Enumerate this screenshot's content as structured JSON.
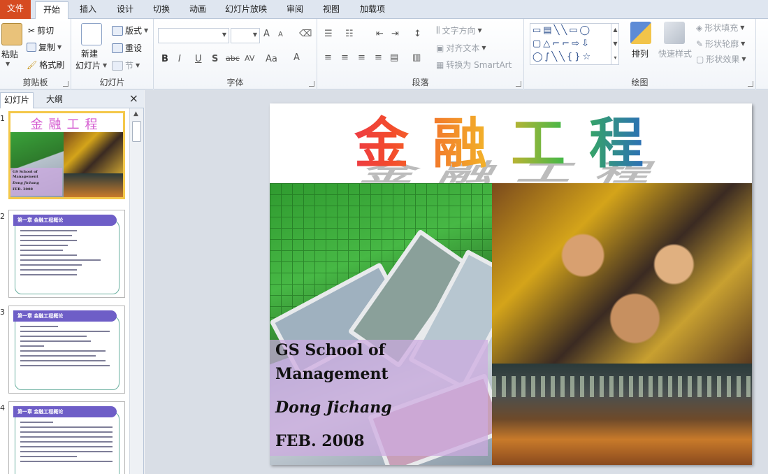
{
  "tabs": [
    "文件",
    "开始",
    "插入",
    "设计",
    "切换",
    "动画",
    "幻灯片放映",
    "审阅",
    "视图",
    "加载项"
  ],
  "ribbon": {
    "clipboard": {
      "paste": "粘贴",
      "cut": "剪切",
      "copy": "复制",
      "format_painter": "格式刷",
      "label": "剪贴板"
    },
    "slides": {
      "new_slide": "新建",
      "new_slide2": "幻灯片",
      "layout": "版式",
      "reset": "重设",
      "section": "节",
      "label": "幻灯片"
    },
    "font": {
      "bold": "B",
      "italic": "I",
      "underline": "U",
      "shadow": "S",
      "strike": "abc",
      "spacing": "AV",
      "case": "Aa",
      "color": "A",
      "grow": "A",
      "shrink": "A",
      "label": "字体"
    },
    "paragraph": {
      "text_direction": "文字方向",
      "align_text": "对齐文本",
      "smartart": "转换为 SmartArt",
      "label": "段落"
    },
    "drawing": {
      "arrange": "排列",
      "quick_styles": "快速样式",
      "shape_fill": "形状填充",
      "shape_outline": "形状轮廓",
      "shape_effects": "形状效果",
      "label": "绘图"
    }
  },
  "panel": {
    "tab_slides": "幻灯片",
    "tab_outline": "大纲",
    "close": "×"
  },
  "thumbnails": [
    {
      "num": "1",
      "title": "金融工程",
      "lines": [
        "GS School of",
        "Management",
        "Dong  Jichang",
        "FEB.  2008"
      ]
    },
    {
      "num": "2",
      "header": "第一章  金融工程概论"
    },
    {
      "num": "3",
      "header": "第一章  金融工程概论"
    },
    {
      "num": "4",
      "header": "第一章  金融工程概论"
    }
  ],
  "slide": {
    "title": "金融工程",
    "line1": "GS School of",
    "line2": "Management",
    "author": "Dong Jichang",
    "date": "FEB. 2008"
  }
}
